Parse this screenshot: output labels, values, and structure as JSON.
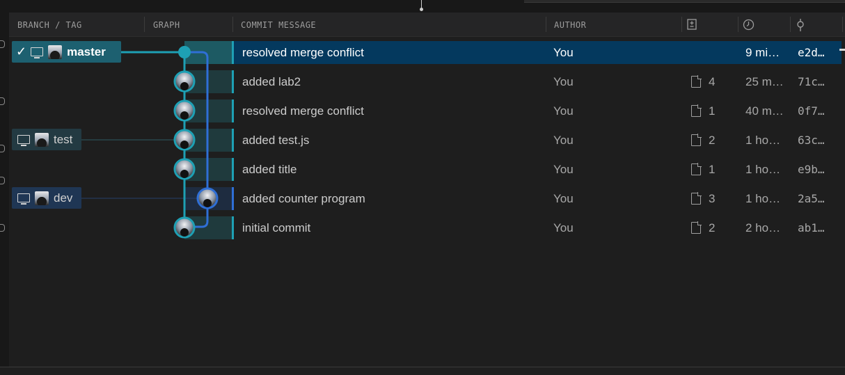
{
  "header": {
    "branch_tag": "BRANCH / TAG",
    "graph": "GRAPH",
    "commit_message": "COMMIT MESSAGE",
    "author": "AUTHOR",
    "changes_icon": "file-diff-icon",
    "date_icon": "clock-icon",
    "sha_icon": "commit-icon"
  },
  "commits": [
    {
      "message": "resolved merge conflict",
      "author": "You",
      "files": "",
      "date": "9 mi…",
      "sha": "e2d…",
      "selected": true
    },
    {
      "message": "added lab2",
      "author": "You",
      "files": "4",
      "date": "25 m…",
      "sha": "71c…"
    },
    {
      "message": "resolved merge conflict",
      "author": "You",
      "files": "1",
      "date": "40 m…",
      "sha": "0f7…"
    },
    {
      "message": "added test.js",
      "author": "You",
      "files": "2",
      "date": "1 ho…",
      "sha": "63c…"
    },
    {
      "message": "added title",
      "author": "You",
      "files": "1",
      "date": "1 ho…",
      "sha": "e9b…"
    },
    {
      "message": "added counter program",
      "author": "You",
      "files": "3",
      "date": "1 ho…",
      "sha": "2a5…"
    },
    {
      "message": "initial commit",
      "author": "You",
      "files": "2",
      "date": "2 ho…",
      "sha": "ab1…"
    }
  ],
  "refs": {
    "master": "master",
    "test": "test",
    "dev": "dev"
  },
  "colors": {
    "graph_teal": "#1ea0b4",
    "graph_blue": "#2f6fd6",
    "selection": "#04395e"
  }
}
